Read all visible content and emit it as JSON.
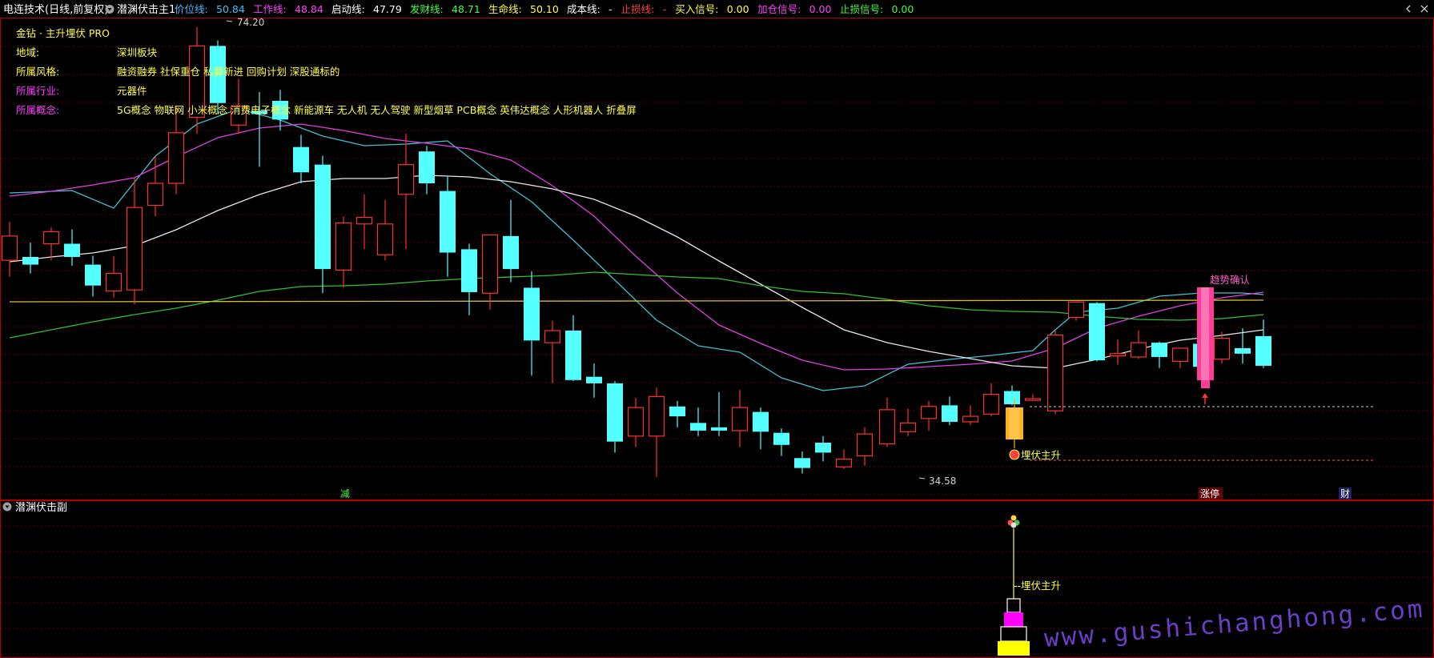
{
  "header": {
    "title": "电连技术(日线,前复权)",
    "indicator_name": "潜渊伏击主1",
    "items": [
      {
        "label": "价位线:",
        "value": "50.84",
        "color": "#40c0ff"
      },
      {
        "label": "工作线:",
        "value": "48.84",
        "color": "#ff40ff"
      },
      {
        "label": "启动线:",
        "value": "47.79",
        "color": "#ffffff"
      },
      {
        "label": "发财线:",
        "value": "48.71",
        "color": "#40ff40"
      },
      {
        "label": "生命线:",
        "value": "50.10",
        "color": "#ffff40"
      },
      {
        "label": "成本线:",
        "value": "-",
        "color": "#ffffff"
      },
      {
        "label": "止损线:",
        "value": "-",
        "color": "#ff4040"
      },
      {
        "label": "买入信号:",
        "value": "0.00",
        "color": "#ffff40"
      },
      {
        "label": "加仓信号:",
        "value": "0.00",
        "color": "#ff40ff"
      },
      {
        "label": "止损信号:",
        "value": "0.00",
        "color": "#40ff40"
      }
    ]
  },
  "info_panel": {
    "brand": "金钻 · 主升埋伏 PRO",
    "rows": [
      {
        "label": "地域:",
        "value": "深圳板块",
        "label_color": "#ffff40"
      },
      {
        "label": "所属风格:",
        "value": "融资融券 社保重仓 私募新进 回购计划 深股通标的",
        "label_color": "#ffff40"
      },
      {
        "label": "所属行业:",
        "value": "元器件",
        "label_color": "#ff40ff"
      },
      {
        "label": "所属概念:",
        "value": "5G概念 物联网 小米概念 消费电子概念 新能源车 无人机 无人驾驶 新型烟草 PCB概念 英伟达概念 人形机器人 折叠屏",
        "label_color": "#ff40ff"
      }
    ]
  },
  "annotations": {
    "high_label": "74.20",
    "low_label": "34.58",
    "buy_signal_label": "埋伏主升",
    "trend_label": "趋势确认",
    "bottom_markers": [
      "减",
      "涨停",
      "财"
    ]
  },
  "sub_panel": {
    "title": "潜渊伏击副",
    "signal_label": "--埋伏主升"
  },
  "watermark": "www.gushichanghong.com",
  "colors": {
    "up": "#ff3030",
    "down": "#54ffff",
    "grid": "#7a0000",
    "frame": "#b00000",
    "ma_cyan": "#40c0d0",
    "ma_magenta": "#e040e0",
    "ma_white": "#e8e8e8",
    "ma_green": "#30c030",
    "ma_yellow": "#d0c030"
  },
  "chart_data": {
    "type": "candlestick",
    "ylim": [
      32,
      78
    ],
    "candles": [
      {
        "o": 53.0,
        "h": 56.5,
        "l": 51.5,
        "c": 55.2
      },
      {
        "o": 53.3,
        "h": 54.6,
        "l": 51.8,
        "c": 52.6
      },
      {
        "o": 54.5,
        "h": 56.0,
        "l": 53.0,
        "c": 55.6
      },
      {
        "o": 54.5,
        "h": 55.8,
        "l": 52.5,
        "c": 53.3
      },
      {
        "o": 52.6,
        "h": 53.4,
        "l": 49.7,
        "c": 50.7
      },
      {
        "o": 50.2,
        "h": 53.4,
        "l": 49.6,
        "c": 51.8
      },
      {
        "o": 50.3,
        "h": 60.5,
        "l": 49.0,
        "c": 57.8
      },
      {
        "o": 58.0,
        "h": 62.5,
        "l": 57.0,
        "c": 60.0
      },
      {
        "o": 60.0,
        "h": 67.0,
        "l": 59.0,
        "c": 64.6
      },
      {
        "o": 66.0,
        "h": 74.2,
        "l": 64.5,
        "c": 72.5
      },
      {
        "o": 72.5,
        "h": 73.0,
        "l": 66.3,
        "c": 67.3
      },
      {
        "o": 65.3,
        "h": 69.5,
        "l": 64.5,
        "c": 67.0
      },
      {
        "o": 66.6,
        "h": 68.3,
        "l": 61.5,
        "c": 66.3
      },
      {
        "o": 67.5,
        "h": 68.5,
        "l": 64.8,
        "c": 65.8
      },
      {
        "o": 63.3,
        "h": 64.4,
        "l": 60.0,
        "c": 61.0
      },
      {
        "o": 61.7,
        "h": 62.5,
        "l": 50.0,
        "c": 52.2
      },
      {
        "o": 52.1,
        "h": 57.0,
        "l": 50.5,
        "c": 56.4
      },
      {
        "o": 56.3,
        "h": 59.0,
        "l": 54.0,
        "c": 56.9
      },
      {
        "o": 53.5,
        "h": 58.5,
        "l": 53.0,
        "c": 56.3
      },
      {
        "o": 59.0,
        "h": 64.5,
        "l": 54.0,
        "c": 61.7
      },
      {
        "o": 62.9,
        "h": 63.4,
        "l": 59.0,
        "c": 60.0
      },
      {
        "o": 59.3,
        "h": 60.6,
        "l": 51.5,
        "c": 53.7
      },
      {
        "o": 54.0,
        "h": 54.5,
        "l": 48.0,
        "c": 50.1
      },
      {
        "o": 50.0,
        "h": 55.0,
        "l": 48.5,
        "c": 55.3
      },
      {
        "o": 55.2,
        "h": 58.5,
        "l": 51.0,
        "c": 52.2
      },
      {
        "o": 50.5,
        "h": 52.0,
        "l": 42.5,
        "c": 45.7
      },
      {
        "o": 45.5,
        "h": 47.5,
        "l": 41.8,
        "c": 46.6
      },
      {
        "o": 46.6,
        "h": 48.0,
        "l": 42.0,
        "c": 42.1
      },
      {
        "o": 42.4,
        "h": 43.6,
        "l": 40.5,
        "c": 41.8
      },
      {
        "o": 41.8,
        "h": 42.0,
        "l": 35.5,
        "c": 36.5
      },
      {
        "o": 37.0,
        "h": 40.5,
        "l": 36.0,
        "c": 39.6
      },
      {
        "o": 37.0,
        "h": 41.4,
        "l": 33.3,
        "c": 40.6
      },
      {
        "o": 39.7,
        "h": 40.2,
        "l": 37.8,
        "c": 38.8
      },
      {
        "o": 38.2,
        "h": 39.6,
        "l": 37.0,
        "c": 37.5
      },
      {
        "o": 37.8,
        "h": 41.0,
        "l": 37.0,
        "c": 37.5
      },
      {
        "o": 37.5,
        "h": 41.2,
        "l": 36.0,
        "c": 39.6
      },
      {
        "o": 39.2,
        "h": 39.6,
        "l": 35.8,
        "c": 37.4
      },
      {
        "o": 37.3,
        "h": 37.7,
        "l": 35.2,
        "c": 36.2
      },
      {
        "o": 35.0,
        "h": 35.6,
        "l": 33.6,
        "c": 34.1
      },
      {
        "o": 36.4,
        "h": 37.0,
        "l": 34.7,
        "c": 35.5
      },
      {
        "o": 34.2,
        "h": 35.8,
        "l": 34.0,
        "c": 34.9
      },
      {
        "o": 35.2,
        "h": 37.8,
        "l": 34.3,
        "c": 37.2
      },
      {
        "o": 36.3,
        "h": 40.5,
        "l": 36.0,
        "c": 39.4
      },
      {
        "o": 37.4,
        "h": 39.5,
        "l": 37.0,
        "c": 38.2
      },
      {
        "o": 38.6,
        "h": 40.2,
        "l": 37.5,
        "c": 39.7
      },
      {
        "o": 39.8,
        "h": 40.6,
        "l": 38.0,
        "c": 38.3
      },
      {
        "o": 38.3,
        "h": 39.8,
        "l": 38.0,
        "c": 38.8
      },
      {
        "o": 39.0,
        "h": 41.8,
        "l": 38.8,
        "c": 40.8
      },
      {
        "o": 41.1,
        "h": 41.6,
        "l": 39.8,
        "c": 39.9
      },
      {
        "o": 40.4,
        "h": 40.8,
        "l": 40.2,
        "c": 40.4
      },
      {
        "o": 39.3,
        "h": 46.6,
        "l": 39.0,
        "c": 46.2
      },
      {
        "o": 47.8,
        "h": 49.0,
        "l": 47.5,
        "c": 49.2
      },
      {
        "o": 49.1,
        "h": 49.2,
        "l": 43.8,
        "c": 43.9
      },
      {
        "o": 44.3,
        "h": 45.8,
        "l": 43.5,
        "c": 44.5
      },
      {
        "o": 44.2,
        "h": 46.6,
        "l": 44.0,
        "c": 45.5
      },
      {
        "o": 45.5,
        "h": 45.6,
        "l": 43.2,
        "c": 44.2
      },
      {
        "o": 43.8,
        "h": 45.0,
        "l": 43.2,
        "c": 45.0
      },
      {
        "o": 45.4,
        "h": 45.6,
        "l": 43.0,
        "c": 43.3
      },
      {
        "o": 44.0,
        "h": 46.5,
        "l": 43.6,
        "c": 45.9
      },
      {
        "o": 45.0,
        "h": 46.8,
        "l": 43.6,
        "c": 44.5
      },
      {
        "o": 46.1,
        "h": 47.6,
        "l": 43.2,
        "c": 43.4
      }
    ],
    "candle_xs": [
      12,
      38,
      64,
      90,
      116,
      142,
      168,
      194,
      220,
      246,
      272,
      298,
      324,
      350,
      376,
      403,
      429,
      455,
      481,
      507,
      533,
      559,
      586,
      612,
      638,
      664,
      690,
      716,
      742,
      768,
      794,
      820,
      846,
      872,
      898,
      924,
      950,
      976,
      1002,
      1028,
      1054,
      1080,
      1108,
      1134,
      1160,
      1186,
      1212,
      1238,
      1264,
      1290,
      1318,
      1344,
      1370,
      1396,
      1422,
      1448,
      1474,
      1500,
      1526,
      1552,
      1578
    ],
    "ma_lines": [
      {
        "name": "价位线",
        "color": "#40c0d0",
        "points": [
          [
            12,
            241
          ],
          [
            90,
            238
          ],
          [
            142,
            260
          ],
          [
            194,
            195
          ],
          [
            246,
            155
          ],
          [
            298,
            136
          ],
          [
            350,
            150
          ],
          [
            403,
            170
          ],
          [
            455,
            182
          ],
          [
            507,
            180
          ],
          [
            559,
            176
          ],
          [
            612,
            217
          ],
          [
            664,
            252
          ],
          [
            716,
            300
          ],
          [
            768,
            350
          ],
          [
            820,
            400
          ],
          [
            872,
            432
          ],
          [
            924,
            440
          ],
          [
            976,
            472
          ],
          [
            1028,
            488
          ],
          [
            1080,
            482
          ],
          [
            1134,
            455
          ],
          [
            1186,
            449
          ],
          [
            1238,
            444
          ],
          [
            1290,
            438
          ],
          [
            1318,
            412
          ],
          [
            1344,
            390
          ],
          [
            1396,
            385
          ],
          [
            1448,
            370
          ],
          [
            1500,
            366
          ],
          [
            1552,
            366
          ],
          [
            1578,
            368
          ]
        ]
      },
      {
        "name": "工作线",
        "color": "#e040e0",
        "points": [
          [
            12,
            245
          ],
          [
            64,
            239
          ],
          [
            116,
            231
          ],
          [
            168,
            222
          ],
          [
            220,
            196
          ],
          [
            272,
            172
          ],
          [
            324,
            160
          ],
          [
            376,
            155
          ],
          [
            429,
            163
          ],
          [
            481,
            173
          ],
          [
            533,
            179
          ],
          [
            586,
            186
          ],
          [
            638,
            200
          ],
          [
            690,
            232
          ],
          [
            742,
            270
          ],
          [
            794,
            320
          ],
          [
            846,
            366
          ],
          [
            898,
            406
          ],
          [
            950,
            429
          ],
          [
            1002,
            450
          ],
          [
            1054,
            462
          ],
          [
            1108,
            461
          ],
          [
            1160,
            458
          ],
          [
            1212,
            455
          ],
          [
            1264,
            451
          ],
          [
            1318,
            435
          ],
          [
            1370,
            410
          ],
          [
            1422,
            395
          ],
          [
            1474,
            382
          ],
          [
            1526,
            372
          ],
          [
            1578,
            365
          ]
        ]
      },
      {
        "name": "启动线",
        "color": "#e8e8e8",
        "points": [
          [
            12,
            327
          ],
          [
            64,
            321
          ],
          [
            116,
            316
          ],
          [
            168,
            307
          ],
          [
            220,
            287
          ],
          [
            272,
            263
          ],
          [
            324,
            243
          ],
          [
            376,
            227
          ],
          [
            429,
            223
          ],
          [
            481,
            223
          ],
          [
            533,
            219
          ],
          [
            586,
            221
          ],
          [
            638,
            227
          ],
          [
            690,
            236
          ],
          [
            742,
            249
          ],
          [
            794,
            270
          ],
          [
            846,
            296
          ],
          [
            898,
            326
          ],
          [
            950,
            355
          ],
          [
            1002,
            384
          ],
          [
            1054,
            412
          ],
          [
            1108,
            428
          ],
          [
            1160,
            439
          ],
          [
            1212,
            448
          ],
          [
            1264,
            457
          ],
          [
            1318,
            460
          ],
          [
            1370,
            449
          ],
          [
            1422,
            436
          ],
          [
            1474,
            425
          ],
          [
            1526,
            419
          ],
          [
            1578,
            412
          ]
        ]
      },
      {
        "name": "发财线",
        "color": "#30c030",
        "points": [
          [
            12,
            422
          ],
          [
            64,
            412
          ],
          [
            116,
            402
          ],
          [
            168,
            393
          ],
          [
            220,
            385
          ],
          [
            272,
            375
          ],
          [
            324,
            364
          ],
          [
            376,
            358
          ],
          [
            429,
            357
          ],
          [
            481,
            355
          ],
          [
            533,
            351
          ],
          [
            586,
            348
          ],
          [
            638,
            346
          ],
          [
            690,
            344
          ],
          [
            742,
            340
          ],
          [
            794,
            343
          ],
          [
            846,
            346
          ],
          [
            898,
            348
          ],
          [
            950,
            357
          ],
          [
            1002,
            364
          ],
          [
            1054,
            367
          ],
          [
            1108,
            374
          ],
          [
            1160,
            382
          ],
          [
            1212,
            387
          ],
          [
            1264,
            389
          ],
          [
            1318,
            390
          ],
          [
            1370,
            395
          ],
          [
            1422,
            399
          ],
          [
            1474,
            400
          ],
          [
            1526,
            398
          ],
          [
            1578,
            393
          ]
        ]
      },
      {
        "name": "生命线",
        "color": "#d0c030",
        "points": [
          [
            12,
            377
          ],
          [
            1578,
            375
          ]
        ]
      }
    ],
    "sub_panel_blocks": [
      {
        "label": "",
        "color": "#ffff00",
        "fill": true
      },
      {
        "label": "",
        "color": "#ffffff",
        "fill": false
      },
      {
        "label": "",
        "color": "#ff00ff",
        "fill": true
      },
      {
        "label": "",
        "color": "#ffffff",
        "fill": false
      }
    ]
  }
}
